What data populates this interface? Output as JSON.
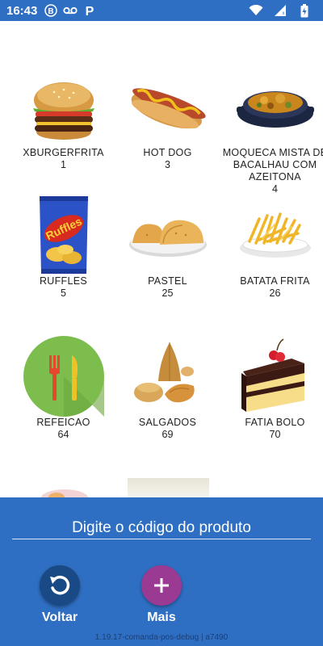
{
  "status_bar": {
    "time": "16:43",
    "icons": [
      "b-badge-icon",
      "voicemail-icon",
      "parking-icon",
      "wifi-icon",
      "signal-icon",
      "battery-charging-icon"
    ]
  },
  "products": [
    {
      "name": "XBURGERFRITA",
      "code": "1",
      "icon": "burger"
    },
    {
      "name": "HOT DOG",
      "code": "3",
      "icon": "hotdog"
    },
    {
      "name": "MOQUECA MISTA DE BACALHAU COM AZEITONA",
      "code": "4",
      "icon": "moqueca"
    },
    {
      "name": "RUFFLES",
      "code": "5",
      "icon": "chips-bag"
    },
    {
      "name": "PASTEL",
      "code": "25",
      "icon": "pastel"
    },
    {
      "name": "BATATA FRITA",
      "code": "26",
      "icon": "fries"
    },
    {
      "name": "REFEICAO",
      "code": "64",
      "icon": "fork-knife"
    },
    {
      "name": "SALGADOS",
      "code": "69",
      "icon": "savory-snacks"
    },
    {
      "name": "FATIA BOLO",
      "code": "70",
      "icon": "cake-slice"
    }
  ],
  "bottom": {
    "input_placeholder": "Digite o código do produto",
    "back_label": "Voltar",
    "more_label": "Mais",
    "version": "1.19.17-comanda-pos-debug | a7490"
  },
  "colors": {
    "primary": "#2f6fc3",
    "back_button": "#1a4a86",
    "more_button": "#9b3a92"
  }
}
